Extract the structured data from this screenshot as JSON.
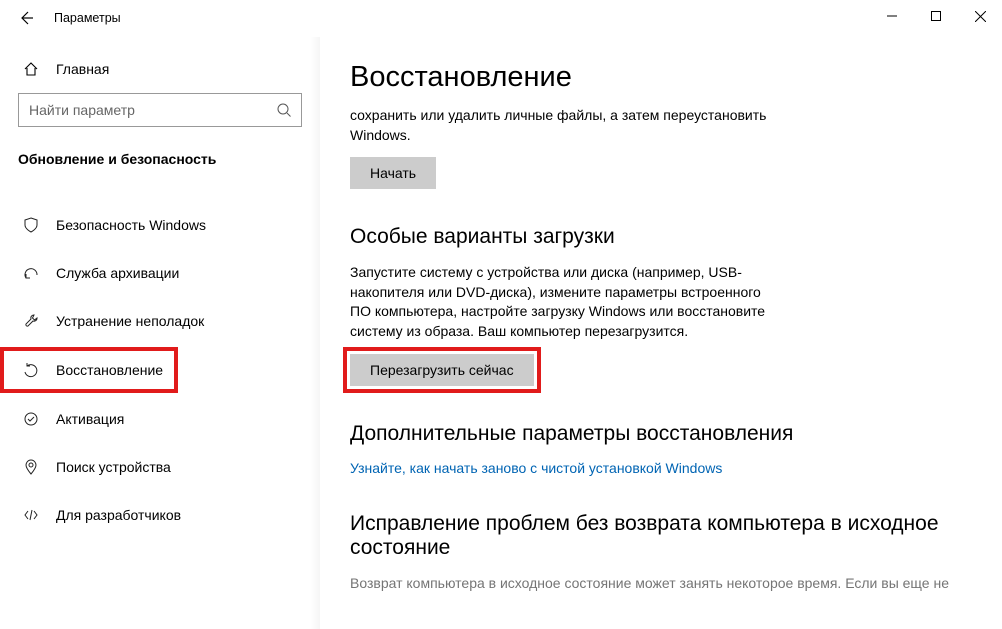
{
  "window": {
    "title": "Параметры"
  },
  "sidebar": {
    "home_label": "Главная",
    "search_placeholder": "Найти параметр",
    "category_heading": "Обновление и безопасность",
    "items": [
      {
        "label": "Безопасность Windows"
      },
      {
        "label": "Служба архивации"
      },
      {
        "label": "Устранение неполадок"
      },
      {
        "label": "Восстановление"
      },
      {
        "label": "Активация"
      },
      {
        "label": "Поиск устройства"
      },
      {
        "label": "Для разработчиков"
      }
    ]
  },
  "main": {
    "page_title": "Восстановление",
    "reset": {
      "desc": "сохранить или удалить личные файлы, а затем переустановить Windows.",
      "button": "Начать"
    },
    "advanced_startup": {
      "heading": "Особые варианты загрузки",
      "desc": "Запустите систему с устройства или диска (например, USB-накопителя или DVD-диска), измените параметры встроенного ПО компьютера, настройте загрузку Windows или восстановите систему из образа. Ваш компьютер перезагрузится.",
      "button": "Перезагрузить сейчас"
    },
    "more_recovery": {
      "heading": "Дополнительные параметры восстановления",
      "link": "Узнайте, как начать заново с чистой установкой Windows"
    },
    "rollback": {
      "heading": "Исправление проблем без возврата компьютера в исходное состояние",
      "desc_cut": "Возврат компьютера в исходное состояние может занять некоторое время. Если вы еще не"
    }
  }
}
